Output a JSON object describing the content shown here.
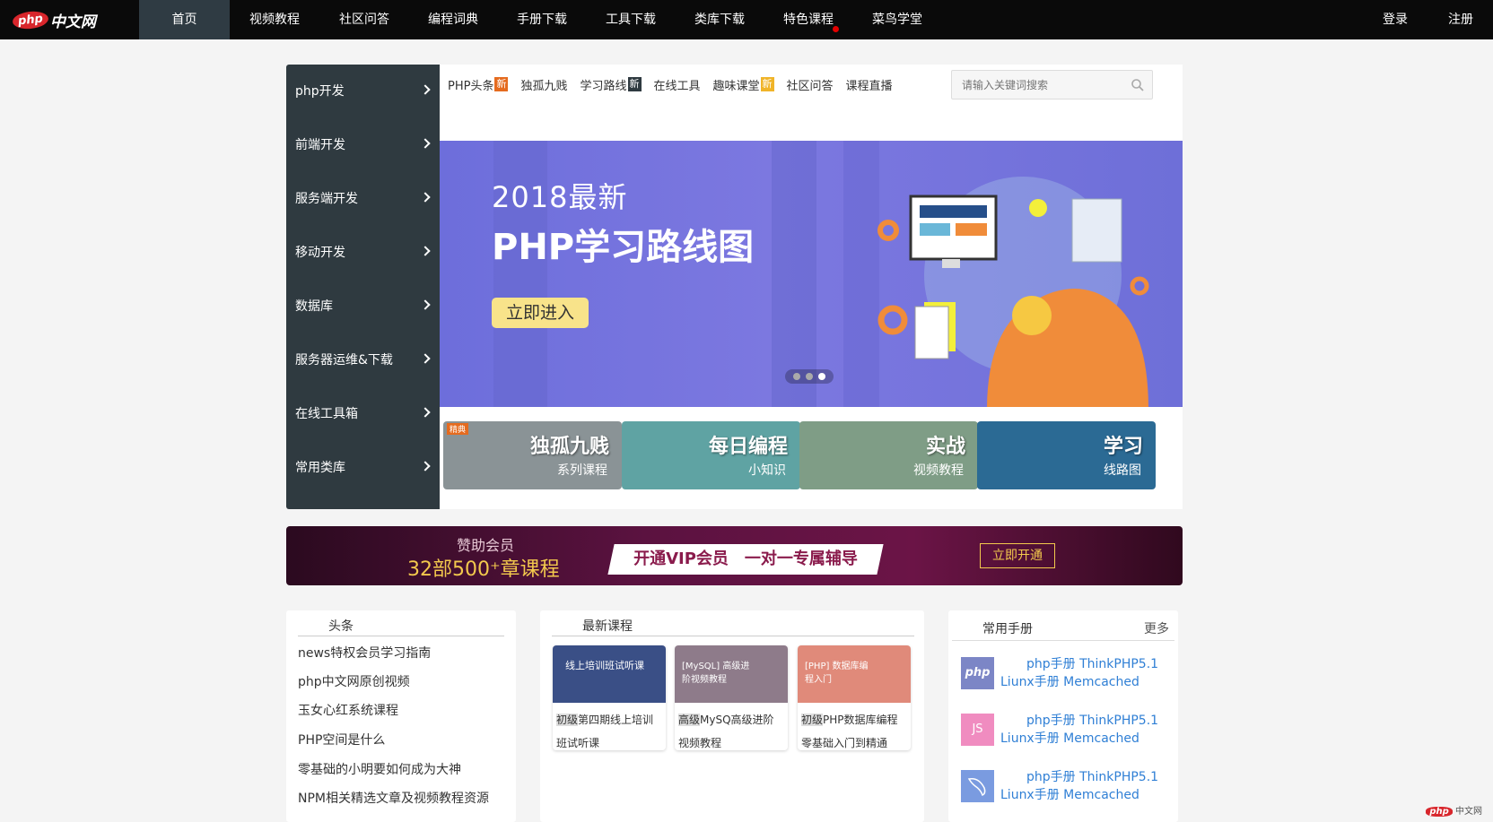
{
  "logo": {
    "mark": "php",
    "text": "中文网"
  },
  "nav": {
    "items": [
      "首页",
      "视频教程",
      "社区问答",
      "编程词典",
      "手册下载",
      "工具下载",
      "类库下载",
      "特色课程",
      "菜鸟学堂"
    ],
    "login": "登录",
    "register": "注册"
  },
  "categories": [
    "php开发",
    "前端开发",
    "服务端开发",
    "移动开发",
    "数据库",
    "服务器运维&下载",
    "在线工具箱",
    "常用类库"
  ],
  "subnav": {
    "items": [
      {
        "label": "PHP头条",
        "badge": "新",
        "badge_color": "#e56b1f"
      },
      {
        "label": "独孤九贱",
        "badge": "",
        "badge_color": ""
      },
      {
        "label": "学习路线",
        "badge": "新",
        "badge_color": "#2f3a40"
      },
      {
        "label": "在线工具",
        "badge": "",
        "badge_color": ""
      },
      {
        "label": "趣味课堂",
        "badge": "新",
        "badge_color": "#f0b429"
      },
      {
        "label": "社区问答",
        "badge": "",
        "badge_color": ""
      },
      {
        "label": "课程直播",
        "badge": "",
        "badge_color": ""
      }
    ],
    "search_placeholder": "请输入关键词搜索"
  },
  "banner": {
    "year_line": "2018最新",
    "title": "PHP学习路线图",
    "button": "立即进入",
    "slides": 3,
    "active_slide": 3
  },
  "features": [
    {
      "title": "独孤九贱",
      "sub": "系列课程",
      "tag": "精典",
      "bg": "#8a9396"
    },
    {
      "title": "每日编程",
      "sub": "小知识",
      "tag": "",
      "bg": "#5fa3a3"
    },
    {
      "title": "实战",
      "sub": "视频教程",
      "tag": "",
      "bg": "#7f9d86"
    },
    {
      "title": "学习",
      "sub": "线路图",
      "tag": "",
      "bg": "#2b6a94"
    }
  ],
  "vip": {
    "line1": "赞助会员",
    "line2": "32部500⁺章课程",
    "slogan": "开通VIP会员　一对一专属辅导",
    "button": "立即开通"
  },
  "headlines": {
    "title": "头条",
    "items": [
      "news特权会员学习指南",
      "php中文网原创视频",
      "玉女心红系统课程",
      "PHP空间是什么",
      "零基础的小明要如何成为大神",
      "NPM相关精选文章及视频教程资源"
    ]
  },
  "courses": {
    "title": "最新课程",
    "items": [
      {
        "level": "初级",
        "name": "第四期线上培训班试听课",
        "img_label": "线上培训班试听课",
        "bg": "#3a4f86"
      },
      {
        "level": "高级",
        "name": "MySQ高级进阶视频教程",
        "img_label": "[MySQL] 高级进阶视频教程",
        "bg": "#8e7b8a"
      },
      {
        "level": "初级",
        "name": "PHP数据库编程零基础入门到精通",
        "img_label": "[PHP] 数据库编程入门",
        "bg": "#e08a7a"
      }
    ]
  },
  "manuals": {
    "title": "常用手册",
    "more": "更多",
    "items": [
      {
        "icon": "php",
        "bg": "#7c86c6",
        "line1": "php手册 ThinkPHP5.1",
        "line2": "Liunx手册 Memcached"
      },
      {
        "icon": "JS",
        "bg": "#f08cc0",
        "line1": "php手册 ThinkPHP5.1",
        "line2": "Liunx手册 Memcached"
      },
      {
        "icon": "",
        "bg": "#7a9be0",
        "line1": "php手册 ThinkPHP5.1",
        "line2": "Liunx手册 Memcached"
      }
    ]
  },
  "watermark": {
    "mark": "php",
    "text": "中文网"
  }
}
